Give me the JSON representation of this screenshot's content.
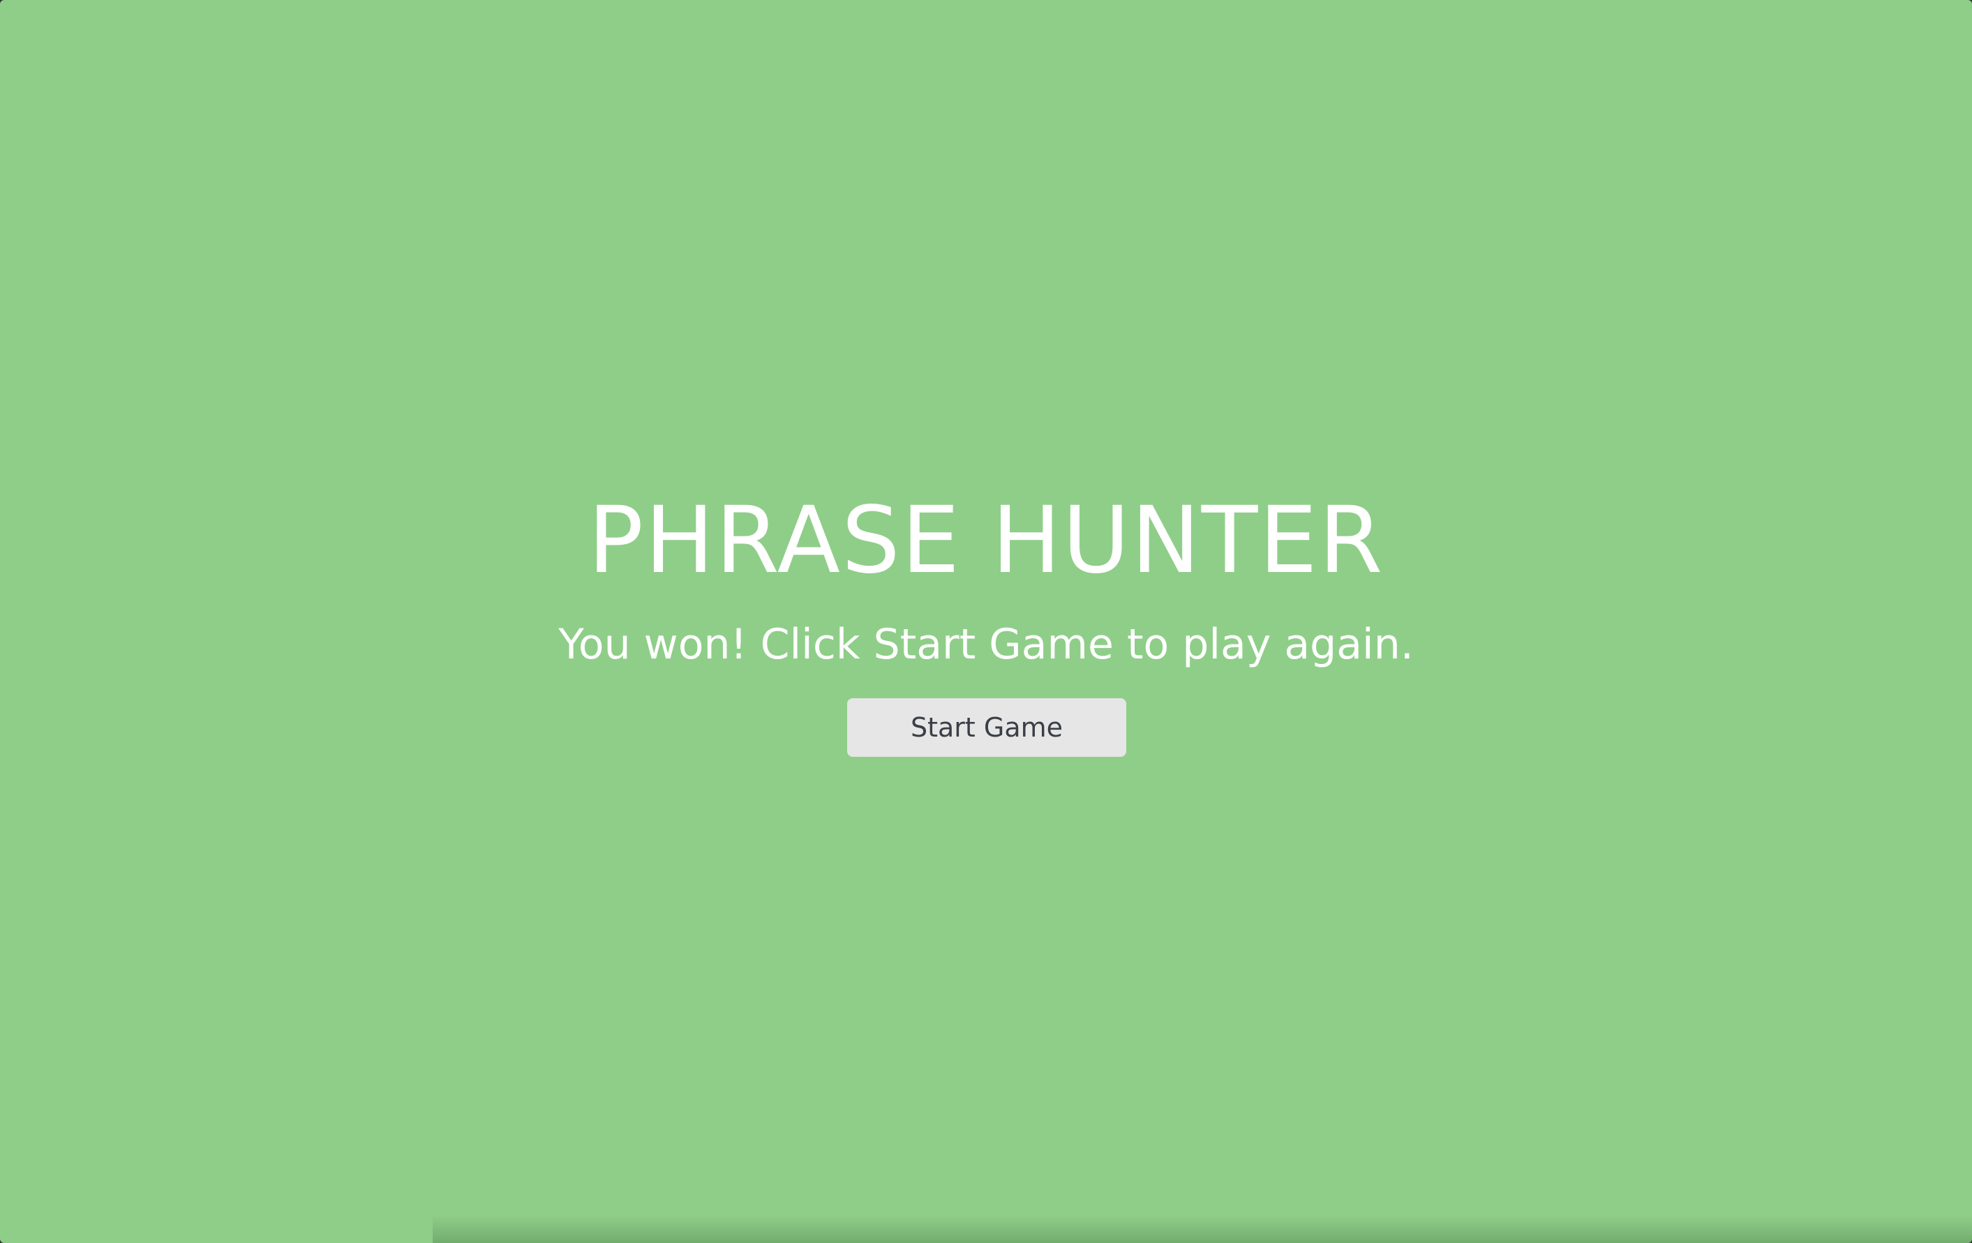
{
  "overlay": {
    "background_color": "#8fce89",
    "title": "PHRASE HUNTER",
    "message": "You won! Click Start Game to play again.",
    "start_button_label": "Start Game"
  }
}
